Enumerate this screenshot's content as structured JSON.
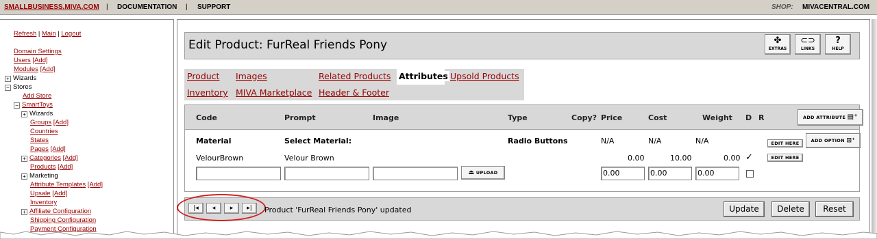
{
  "topbar": {
    "site": "SMALLBUSINESS.MIVA.COM",
    "sep": "|",
    "docs": "DOCUMENTATION",
    "support": "SUPPORT",
    "shop_label": "SHOP:",
    "shop_value": "MIVACENTRAL.COM"
  },
  "sidebar": {
    "refresh": "Refresh",
    "main": "Main",
    "logout": "Logout",
    "pipe": "|",
    "domain_settings": "Domain Settings",
    "users": "Users",
    "modules": "Modules",
    "add": "[Add]",
    "wizards": "Wizards",
    "stores": "Stores",
    "add_store": "Add Store",
    "smarttoys": "SmartToys",
    "store_wizards": "Wizards",
    "groups": "Groups",
    "countries": "Countries",
    "states": "States",
    "pages": "Pages",
    "categories": "Categories",
    "products": "Products",
    "marketing": "Marketing",
    "attribute_templates": "Attribute Templates",
    "upsale": "Upsale",
    "inventory": "Inventory",
    "affiliate_configuration": "Affiliate Configuration",
    "shipping_configuration": "Shipping Configuration",
    "payment_configuration": "Payment Configuration",
    "plus": "+",
    "minus": "−"
  },
  "header": {
    "title": "Edit Product: FurReal Friends Pony",
    "extras": "EXTRAS",
    "links": "LINKS",
    "help": "HELP",
    "help_glyph": "?"
  },
  "tabs": {
    "product": "Product",
    "images": "Images",
    "related": "Related Products",
    "attributes": "Attributes",
    "upsold": "Upsold Products",
    "inventory": "Inventory",
    "marketplace": "MIVA Marketplace",
    "header_footer": "Header & Footer"
  },
  "attributes": {
    "columns": {
      "code": "Code",
      "prompt": "Prompt",
      "image": "Image",
      "type": "Type",
      "copy": "Copy?",
      "price": "Price",
      "cost": "Cost",
      "weight": "Weight",
      "d": "D",
      "r": "R"
    },
    "add_attribute": "ADD ATTRIBUTE",
    "add_option": "ADD OPTION",
    "edit_here": "EDIT HERE",
    "upload": "UPLOAD",
    "attribute_row": {
      "code": "Material",
      "prompt": "Select Material:",
      "type": "Radio Buttons",
      "price": "N/A",
      "cost": "N/A",
      "weight": "N/A"
    },
    "option_row": {
      "code": "VelourBrown",
      "prompt": "Velour Brown",
      "price": "0.00",
      "cost": "10.00",
      "weight": "0.00",
      "default_mark": "✓"
    },
    "new_row": {
      "price": "0.00",
      "cost": "0.00",
      "weight": "0.00"
    }
  },
  "footer": {
    "message": "Product 'FurReal Friends Pony' updated",
    "update": "Update",
    "delete": "Delete",
    "reset": "Reset",
    "nav_first": "|◂",
    "nav_prev": "◂",
    "nav_next": "▸",
    "nav_last": "▸|"
  },
  "colors": {
    "link": "#990000",
    "panel": "#d8d8d8",
    "highlight_circle": "#d02020"
  }
}
